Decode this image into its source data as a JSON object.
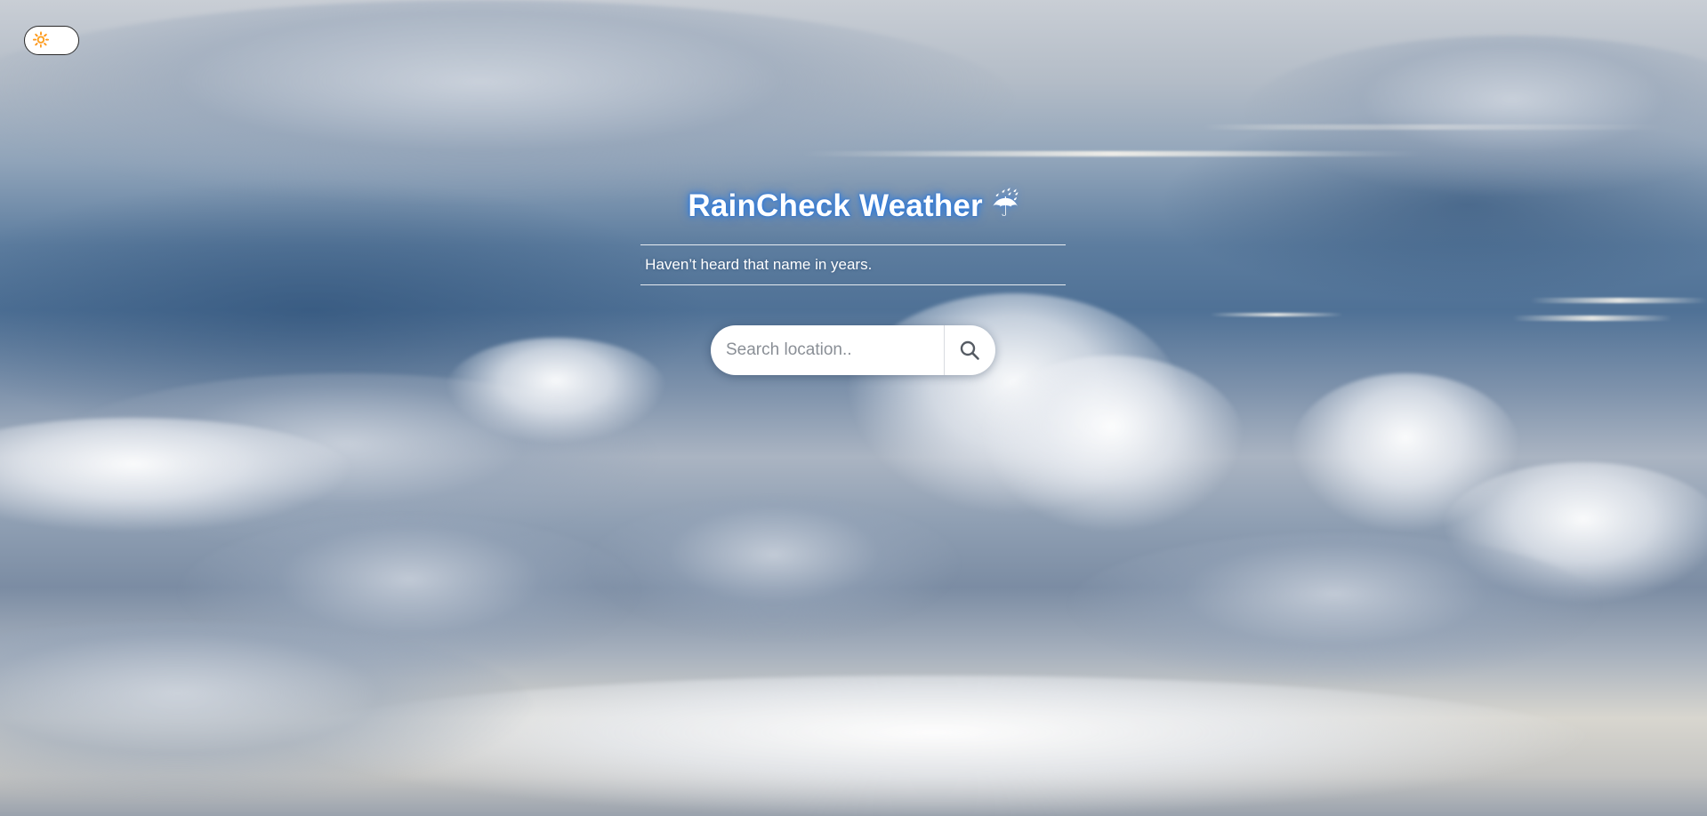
{
  "theme_toggle": {
    "icon": "sun-icon",
    "glyph": "🔆"
  },
  "header": {
    "title": "RainCheck Weather",
    "title_icon": "umbrella-icon",
    "title_glyph": "☔"
  },
  "tagline": {
    "text": "? Haven’t heard that name in years."
  },
  "search": {
    "placeholder": "Search location..",
    "value": "",
    "button_icon": "search-icon"
  },
  "colors": {
    "title_glow": "#2f7de0",
    "search_bg": "#ffffff",
    "toggle_border": "#2a2a2a"
  }
}
